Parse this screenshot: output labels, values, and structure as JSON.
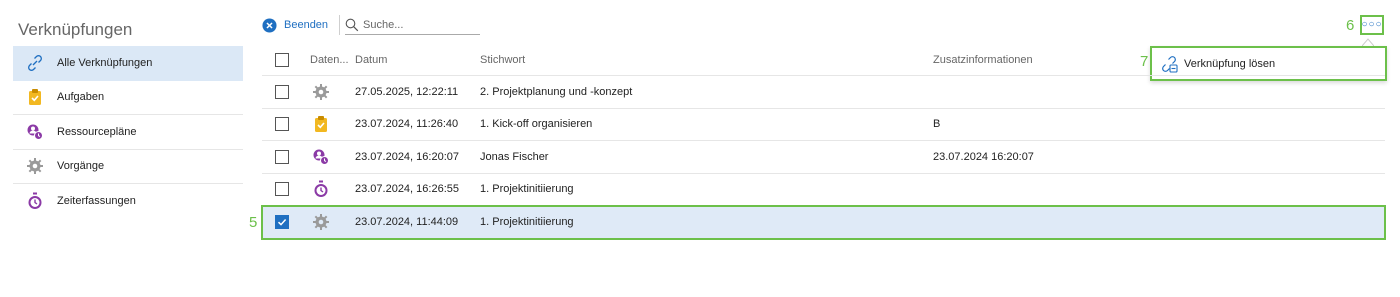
{
  "sidebar": {
    "title": "Verknüpfungen",
    "items": [
      {
        "label": "Alle Verknüpfungen",
        "icon": "link-icon",
        "active": true
      },
      {
        "label": "Aufgaben",
        "icon": "clipboard-check-icon"
      },
      {
        "label": "Ressourcepläne",
        "icon": "resource-plan-icon"
      },
      {
        "label": "Vorgänge",
        "icon": "gear-icon"
      },
      {
        "label": "Zeiterfassungen",
        "icon": "stopwatch-icon"
      }
    ]
  },
  "toolbar": {
    "end_label": "Beenden",
    "search_placeholder": "Suche..."
  },
  "markers": {
    "row_marker": "5",
    "more_marker": "6",
    "popup_marker": "7"
  },
  "popup": {
    "label": "Verknüpfung lösen"
  },
  "table": {
    "headers": {
      "type": "Daten...",
      "date": "Datum",
      "keyword": "Stichwort",
      "extra": "Zusatzinformationen"
    },
    "rows": [
      {
        "icon": "gear-icon",
        "date": "27.05.2025, 12:22:11",
        "keyword": "2. Projektplanung und -konzept",
        "extra": "",
        "checked": false
      },
      {
        "icon": "clipboard-check-icon",
        "date": "23.07.2024, 11:26:40",
        "keyword": "1. Kick-off organisieren",
        "extra": "B",
        "checked": false
      },
      {
        "icon": "resource-plan-icon",
        "date": "23.07.2024, 16:20:07",
        "keyword": "Jonas Fischer",
        "extra": "23.07.2024 16:20:07",
        "checked": false
      },
      {
        "icon": "stopwatch-icon",
        "date": "23.07.2024, 16:26:55",
        "keyword": "1. Projektinitiierung",
        "extra": "",
        "checked": false
      },
      {
        "icon": "gear-icon",
        "date": "23.07.2024, 11:44:09",
        "keyword": "1. Projektinitiierung",
        "extra": "",
        "checked": true
      }
    ]
  },
  "colors": {
    "accent": "#1f6fc1",
    "highlight": "#6cc04a",
    "selected_bg": "#dfeaf7",
    "purple": "#8b3aa6",
    "yellow": "#f2b821"
  }
}
